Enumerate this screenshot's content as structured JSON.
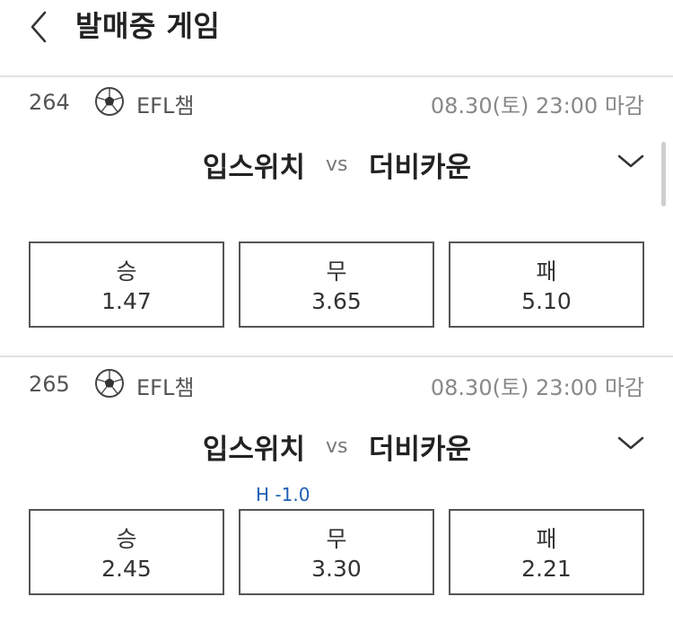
{
  "header": {
    "title": "발매중 게임",
    "back_icon": "chevron-left-icon"
  },
  "games": [
    {
      "no": "264",
      "league_icon": "soccer-ball-icon",
      "league": "EFL챔",
      "deadline": "08.30(토) 23:00 마감",
      "home": "입스위치",
      "vs": "vs",
      "away": "더비카운",
      "handicap": "",
      "odds": [
        {
          "label": "승",
          "value": "1.47"
        },
        {
          "label": "무",
          "value": "3.65"
        },
        {
          "label": "패",
          "value": "5.10"
        }
      ]
    },
    {
      "no": "265",
      "league_icon": "soccer-ball-icon",
      "league": "EFL챔",
      "deadline": "08.30(토) 23:00 마감",
      "home": "입스위치",
      "vs": "vs",
      "away": "더비카운",
      "handicap": "H -1.0",
      "odds": [
        {
          "label": "승",
          "value": "2.45"
        },
        {
          "label": "무",
          "value": "3.30"
        },
        {
          "label": "패",
          "value": "2.21"
        }
      ]
    }
  ],
  "colors": {
    "handicap": "#1f5fb5",
    "divider": "#e2e2e2",
    "box_border": "#555555"
  }
}
